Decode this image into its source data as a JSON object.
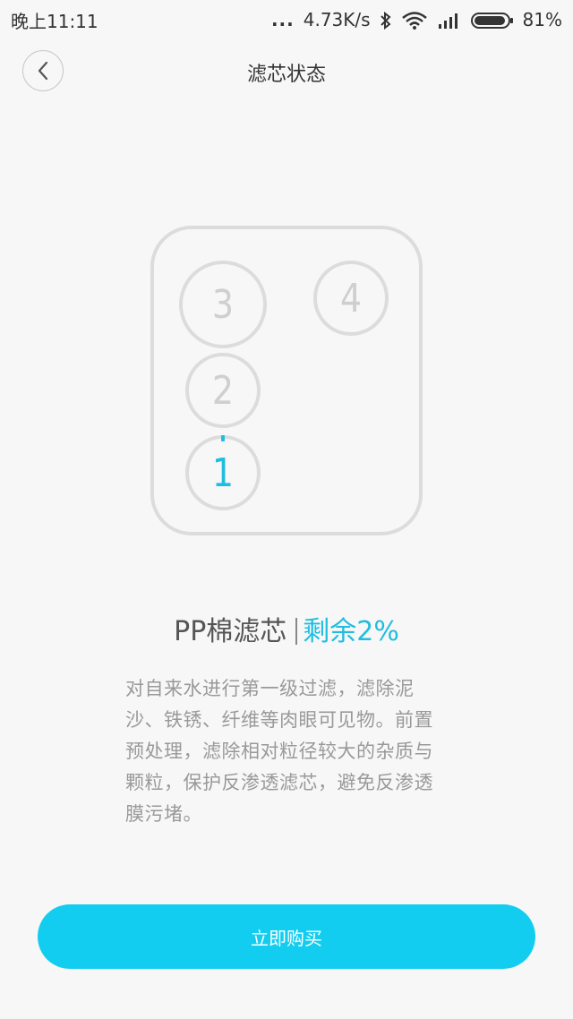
{
  "status_bar": {
    "time": "晚上11:11",
    "signal_dots": "...",
    "network_speed": "4.73K/s",
    "battery_percent": "81%",
    "icons": [
      "bluetooth-icon",
      "wifi-icon",
      "cellular-signal-icon",
      "battery-icon"
    ]
  },
  "header": {
    "back_icon": "chevron-left-icon",
    "title": "滤芯状态"
  },
  "diagram": {
    "slots": [
      {
        "label": "3"
      },
      {
        "label": "4"
      },
      {
        "label": "2"
      },
      {
        "label": "1",
        "active": true,
        "remaining_fraction": 0.02
      }
    ]
  },
  "filter": {
    "name": "PP棉滤芯",
    "remaining_text": "剩余2%",
    "description": "对自来水进行第一级过滤，滤除泥沙、铁锈、纤维等肉眼可见物。前置预处理，滤除相对粒径较大的杂质与颗粒，保护反渗透滤芯，避免反渗透膜污堵。"
  },
  "actions": {
    "buy_label": "立即购买"
  },
  "colors": {
    "accent": "#1fbde0",
    "button": "#12cdf0",
    "inactive": "#dcdcdc",
    "background": "#f7f7f7"
  }
}
